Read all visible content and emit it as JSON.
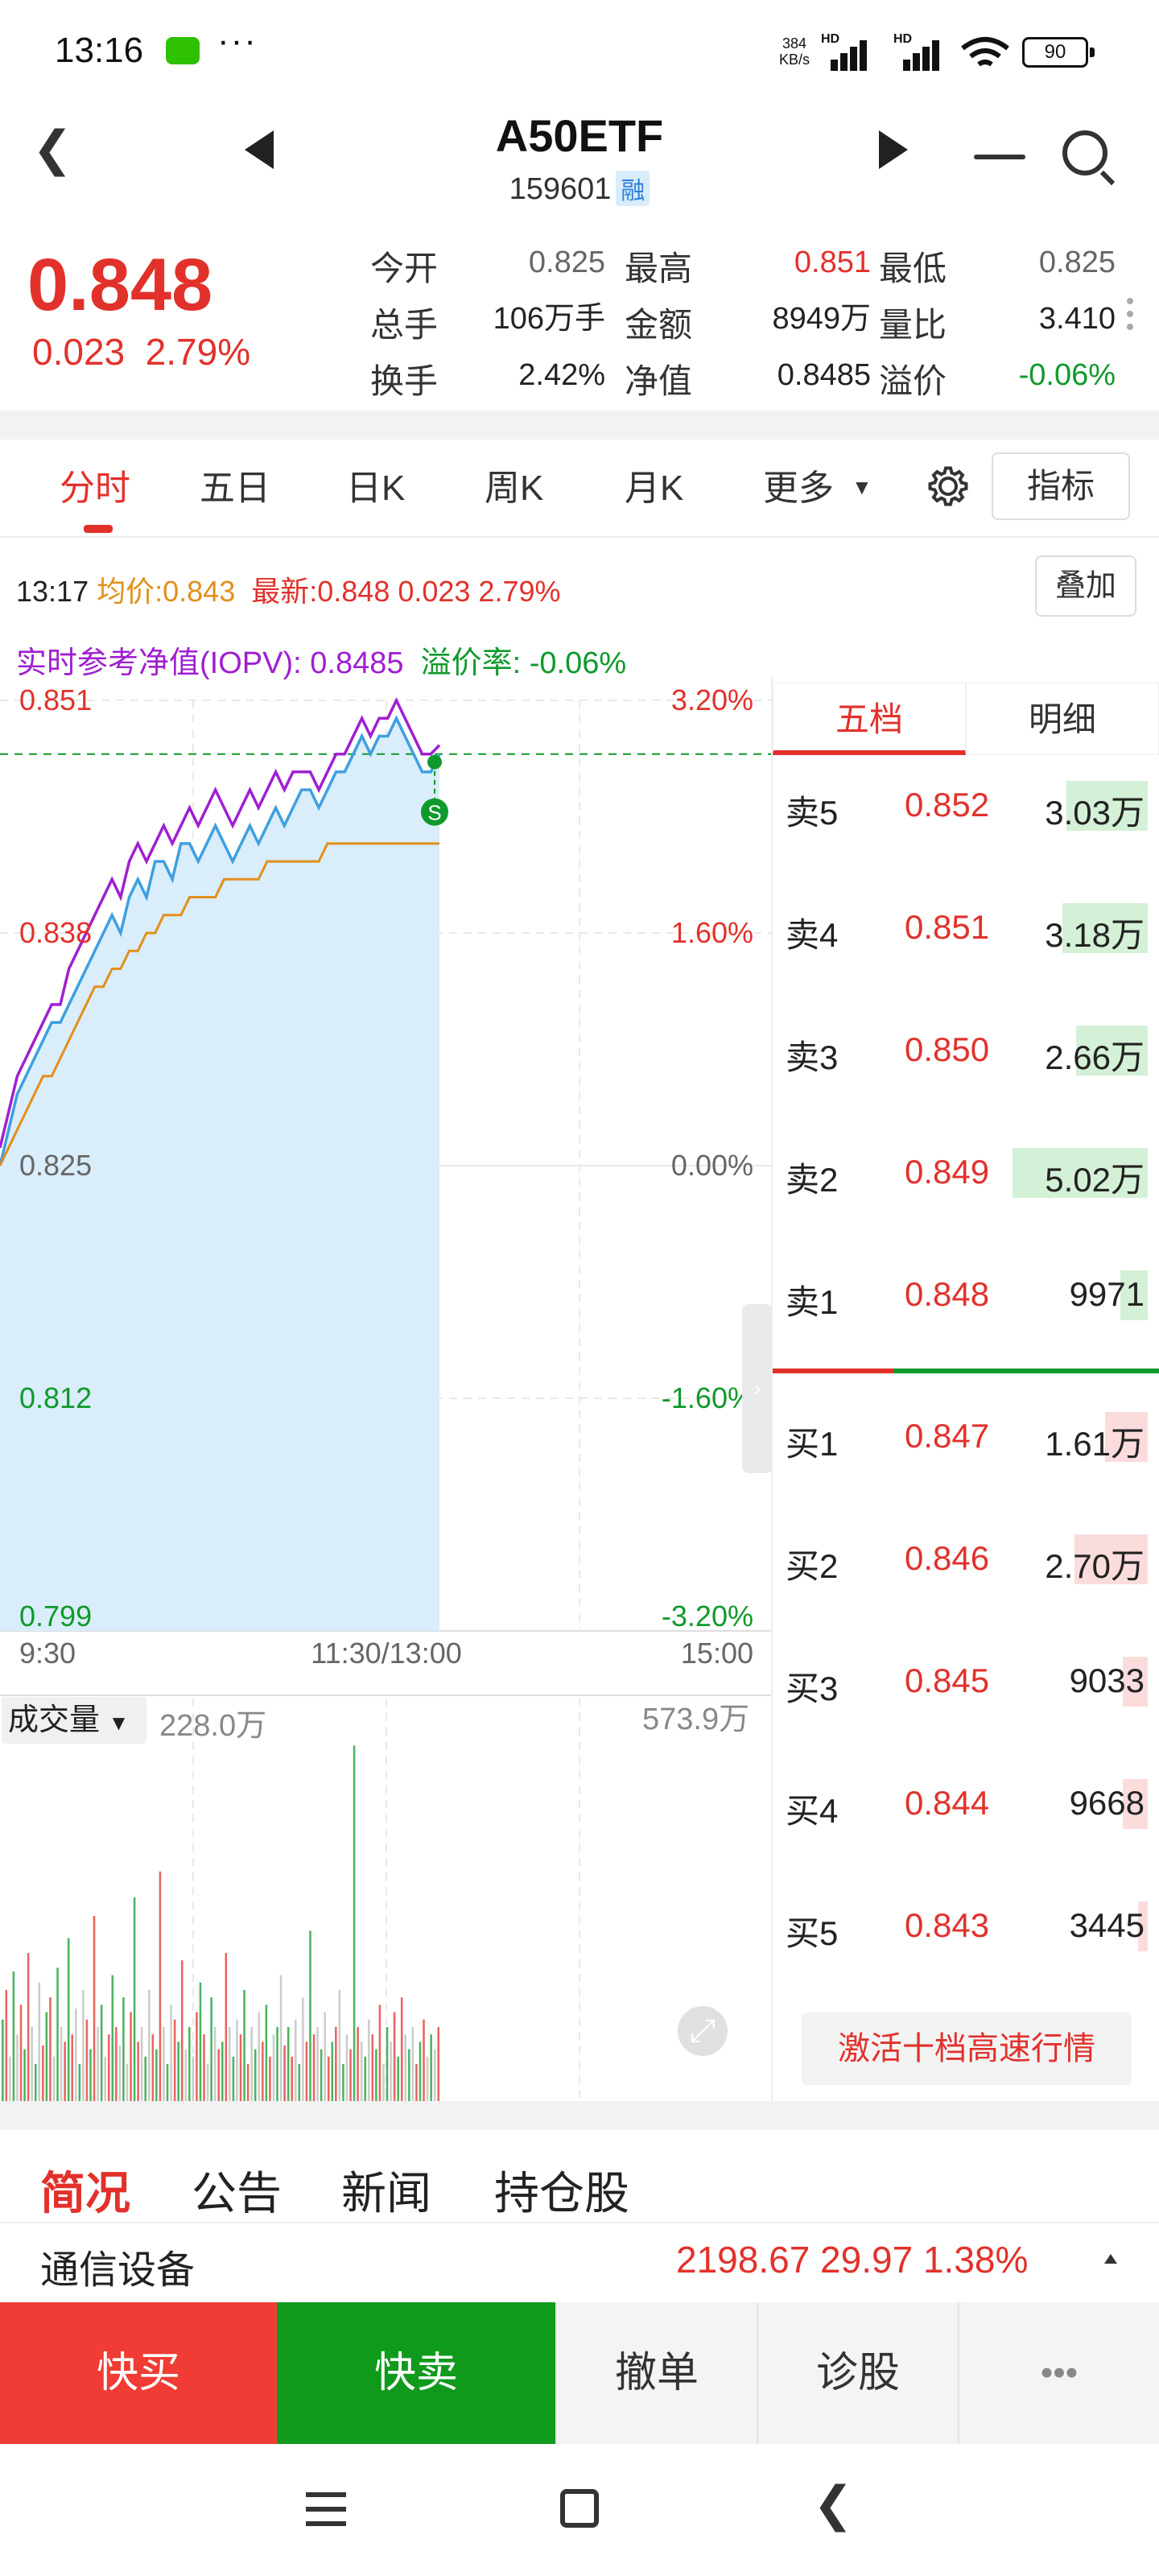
{
  "status_bar": {
    "time": "13:16",
    "dots": "···",
    "speed_top": "384",
    "speed_bottom": "KB/s",
    "hd": "HD",
    "battery": "90",
    "icons": [
      "wechat-icon",
      "signal-icon",
      "wifi-icon",
      "battery-icon"
    ]
  },
  "header": {
    "title": "A50ETF",
    "code": "159601",
    "badge": "融"
  },
  "quote": {
    "price": "0.848",
    "change": "0.023",
    "change_pct": "2.79%",
    "rows": [
      [
        {
          "label": "今开",
          "value": "0.825",
          "color": "neutral"
        },
        {
          "label": "最高",
          "value": "0.851",
          "color": "red"
        },
        {
          "label": "最低",
          "value": "0.825",
          "color": "neutral"
        }
      ],
      [
        {
          "label": "总手",
          "value": "106万手",
          "color": "dark"
        },
        {
          "label": "金额",
          "value": "8949万",
          "color": "dark"
        },
        {
          "label": "量比",
          "value": "3.410",
          "color": "dark"
        }
      ],
      [
        {
          "label": "换手",
          "value": "2.42%",
          "color": "dark"
        },
        {
          "label": "净值",
          "value": "0.8485",
          "color": "dark"
        },
        {
          "label": "溢价",
          "value": "-0.06%",
          "color": "green"
        }
      ]
    ]
  },
  "tabs": {
    "items": [
      "分时",
      "五日",
      "日K",
      "周K",
      "月K",
      "更多"
    ],
    "active": "分时",
    "indicator_button": "指标"
  },
  "chart_info": {
    "time": "13:17",
    "avg_label": "均价:",
    "avg_value": "0.843",
    "latest_label": "最新:",
    "latest_value": "0.848 0.023 2.79%",
    "overlay_button": "叠加",
    "iopv_label": "实时参考净值(IOPV):",
    "iopv_value": "0.8485",
    "premium_label": "溢价率:",
    "premium_value": "-0.06%"
  },
  "chart_data": {
    "type": "line",
    "yaxis_left": [
      "0.851",
      "0.838",
      "0.825",
      "0.812",
      "0.799"
    ],
    "yaxis_right": [
      "3.20%",
      "1.60%",
      "0.00%",
      "-1.60%",
      "-3.20%"
    ],
    "xaxis": [
      "9:30",
      "11:30/13:00",
      "15:00"
    ],
    "ylim": [
      0.799,
      0.851
    ],
    "prev_close": 0.825,
    "last_price": 0.848,
    "signal_marker": "S",
    "series": [
      {
        "color": "#3ea0e0",
        "values": [
          0.825,
          0.827,
          0.829,
          0.83,
          0.831,
          0.832,
          0.833,
          0.833,
          0.834,
          0.835,
          0.836,
          0.837,
          0.838,
          0.839,
          0.838,
          0.84,
          0.841,
          0.84,
          0.842,
          0.842,
          0.841,
          0.843,
          0.843,
          0.842,
          0.843,
          0.844,
          0.843,
          0.842,
          0.843,
          0.844,
          0.843,
          0.844,
          0.845,
          0.844,
          0.845,
          0.846,
          0.846,
          0.845,
          0.846,
          0.847,
          0.847,
          0.848,
          0.849,
          0.848,
          0.849,
          0.849,
          0.85,
          0.849,
          0.848,
          0.847,
          0.847,
          0.848
        ]
      },
      {
        "color": "#a01fd0",
        "values": [
          0.826,
          0.828,
          0.83,
          0.831,
          0.832,
          0.833,
          0.834,
          0.834,
          0.836,
          0.837,
          0.838,
          0.839,
          0.84,
          0.841,
          0.84,
          0.842,
          0.843,
          0.842,
          0.843,
          0.844,
          0.843,
          0.844,
          0.845,
          0.844,
          0.845,
          0.846,
          0.845,
          0.844,
          0.845,
          0.846,
          0.845,
          0.846,
          0.847,
          0.846,
          0.847,
          0.847,
          0.847,
          0.846,
          0.847,
          0.848,
          0.848,
          0.849,
          0.85,
          0.849,
          0.85,
          0.85,
          0.851,
          0.85,
          0.849,
          0.848,
          0.848,
          0.8485
        ]
      },
      {
        "color": "#e0901a",
        "values": [
          0.825,
          0.826,
          0.827,
          0.828,
          0.829,
          0.83,
          0.83,
          0.831,
          0.832,
          0.833,
          0.834,
          0.835,
          0.835,
          0.836,
          0.836,
          0.837,
          0.837,
          0.838,
          0.838,
          0.839,
          0.839,
          0.839,
          0.84,
          0.84,
          0.84,
          0.84,
          0.841,
          0.841,
          0.841,
          0.841,
          0.841,
          0.842,
          0.842,
          0.842,
          0.842,
          0.842,
          0.842,
          0.842,
          0.843,
          0.843,
          0.843,
          0.843,
          0.843,
          0.843,
          0.843,
          0.843,
          0.843,
          0.843,
          0.843,
          0.843,
          0.843,
          0.843
        ]
      }
    ]
  },
  "volume": {
    "label": "成交量",
    "value": "228.0万",
    "max": "573.9万",
    "bars": [
      0.22,
      0.3,
      0.12,
      0.35,
      0.18,
      0.26,
      0.14,
      0.4,
      0.2,
      0.1,
      0.32,
      0.15,
      0.24,
      0.28,
      0.12,
      0.36,
      0.2,
      0.16,
      0.44,
      0.18,
      0.25,
      0.1,
      0.3,
      0.22,
      0.14,
      0.5,
      0.2,
      0.26,
      0.12,
      0.18,
      0.34,
      0.2,
      0.15,
      0.28,
      0.1,
      0.24,
      0.55,
      0.16,
      0.2,
      0.12,
      0.3,
      0.18,
      0.14,
      0.62,
      0.2,
      0.1,
      0.26,
      0.22,
      0.16,
      0.38,
      0.14,
      0.2,
      0.12,
      0.24,
      0.32,
      0.18,
      0.1,
      0.28,
      0.2,
      0.14,
      0.16,
      0.4,
      0.2,
      0.12,
      0.22,
      0.18,
      0.3,
      0.1,
      0.2,
      0.14,
      0.24,
      0.16,
      0.26,
      0.12,
      0.18,
      0.2,
      0.34,
      0.15,
      0.2,
      0.12,
      0.22,
      0.1,
      0.28,
      0.16,
      0.46,
      0.18,
      0.2,
      0.14,
      0.24,
      0.12,
      0.16,
      0.2,
      0.3,
      0.1,
      0.18,
      0.14,
      0.96,
      0.2,
      0.16,
      0.12,
      0.22,
      0.18,
      0.14,
      0.26,
      0.1,
      0.2,
      0.16,
      0.24,
      0.12,
      0.28,
      0.18,
      0.14,
      0.2,
      0.1,
      0.16,
      0.22,
      0.12,
      0.18,
      0.14,
      0.2
    ]
  },
  "order_book": {
    "tabs": [
      "五档",
      "明细"
    ],
    "active": "五档",
    "asks": [
      {
        "label": "卖5",
        "price": "0.852",
        "volume": "3.03万",
        "bar": 0.42
      },
      {
        "label": "卖4",
        "price": "0.851",
        "volume": "3.18万",
        "bar": 0.44
      },
      {
        "label": "卖3",
        "price": "0.850",
        "volume": "2.66万",
        "bar": 0.37
      },
      {
        "label": "卖2",
        "price": "0.849",
        "volume": "5.02万",
        "bar": 0.7
      },
      {
        "label": "卖1",
        "price": "0.848",
        "volume": "9971",
        "bar": 0.14
      }
    ],
    "bids": [
      {
        "label": "买1",
        "price": "0.847",
        "volume": "1.61万",
        "bar": 0.22
      },
      {
        "label": "买2",
        "price": "0.846",
        "volume": "2.70万",
        "bar": 0.38
      },
      {
        "label": "买3",
        "price": "0.845",
        "volume": "9033",
        "bar": 0.13
      },
      {
        "label": "买4",
        "price": "0.844",
        "volume": "9668",
        "bar": 0.13
      },
      {
        "label": "买5",
        "price": "0.843",
        "volume": "3445",
        "bar": 0.05
      }
    ],
    "activate_button": "激活十档高速行情"
  },
  "bottom_tabs": {
    "items": [
      "简况",
      "公告",
      "新闻",
      "持仓股"
    ],
    "active": "简况"
  },
  "sector": {
    "name": "通信设备",
    "values": "2198.67  29.97  1.38%"
  },
  "actions": {
    "buy": "快买",
    "sell": "快卖",
    "cancel": "撤单",
    "diagnose": "诊股",
    "more": "•••"
  },
  "colors": {
    "up": "#e2312b",
    "down": "#0f9a2b",
    "price_line": "#3ea0e0",
    "iopv_line": "#a01fd0",
    "avg_line": "#e0901a"
  }
}
